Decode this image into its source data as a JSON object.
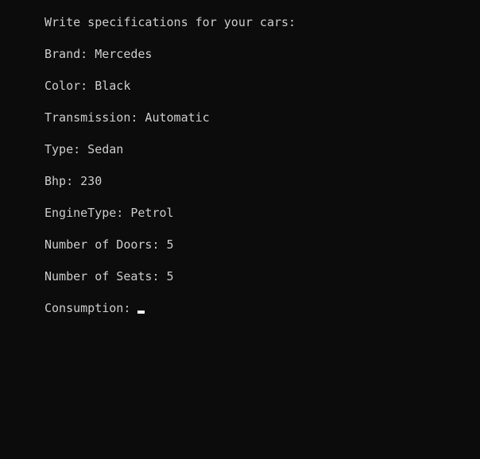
{
  "console": {
    "prompt": "Write specifications for your cars:",
    "lines": [
      "Brand: Mercedes",
      "Color: Black",
      "Transmission: Automatic",
      "Type: Sedan",
      "Bhp: 230",
      "EngineType: Petrol",
      "Number of Doors: 5",
      "Number of Seats: 5"
    ],
    "current_input_label": "Consumption:",
    "current_input_value": ""
  }
}
